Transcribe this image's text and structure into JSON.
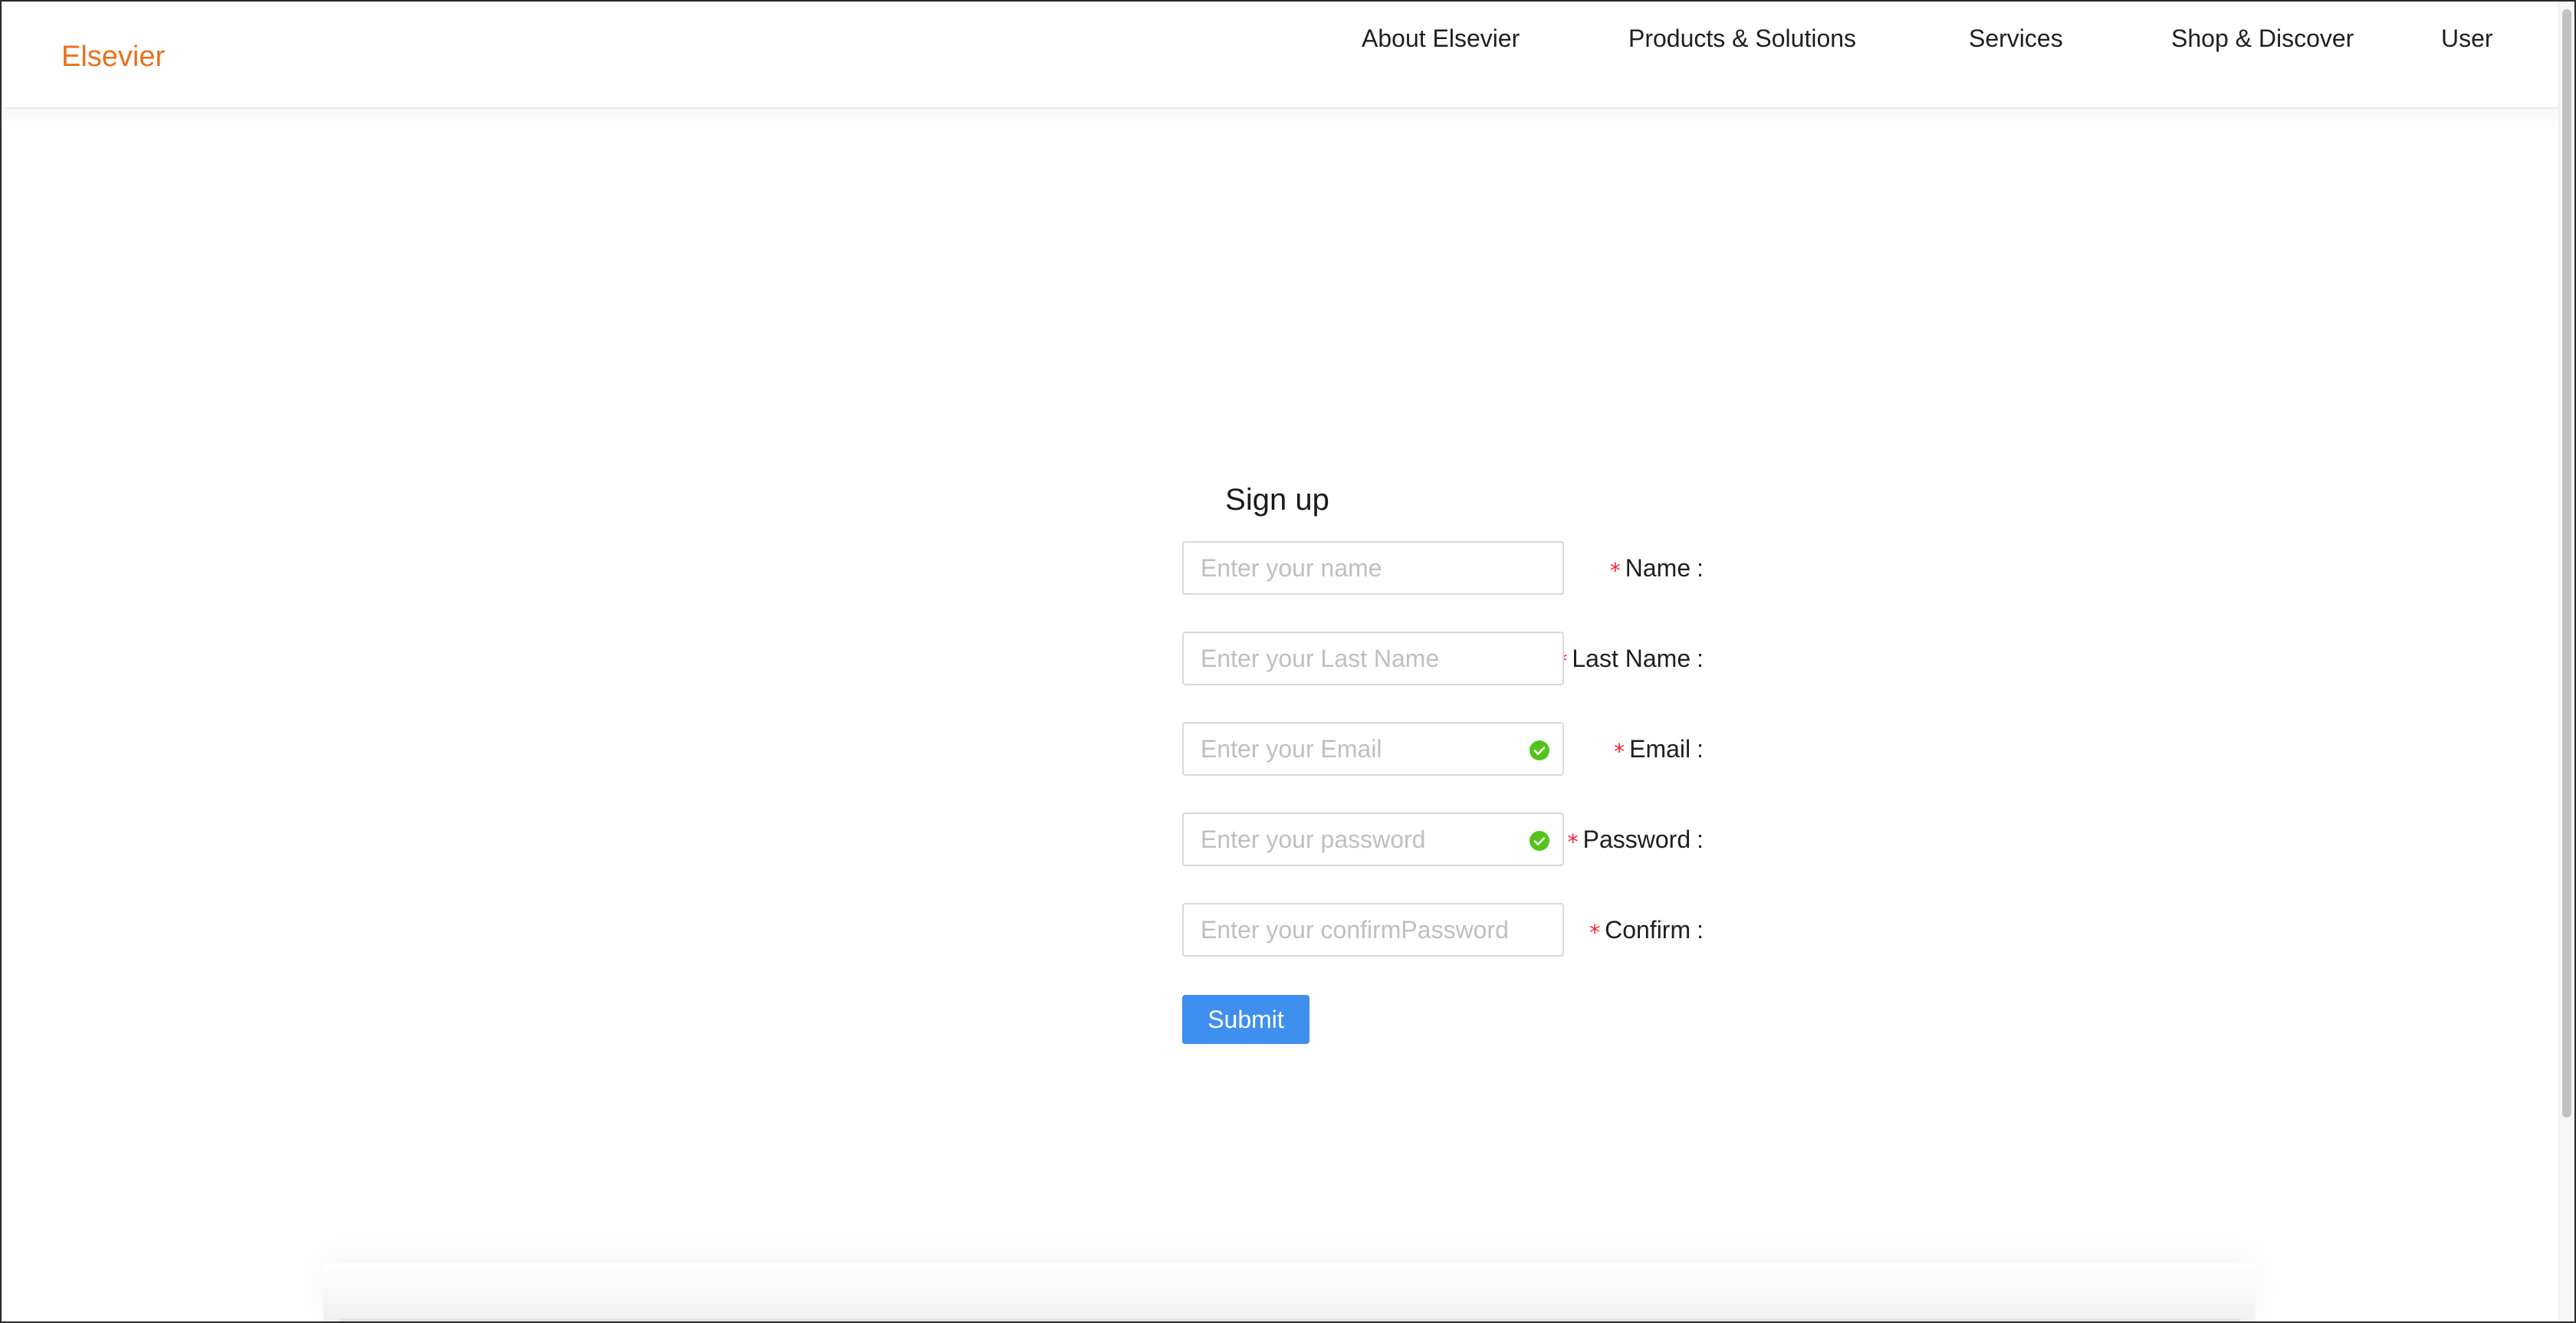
{
  "header": {
    "logo": "Elsevier",
    "nav": [
      {
        "label": "About Elsevier"
      },
      {
        "label": "Products & Solutions"
      },
      {
        "label": "Services"
      },
      {
        "label": "Shop & Discover"
      },
      {
        "label": "User"
      }
    ]
  },
  "form": {
    "title": "Sign up",
    "required_marker": "*",
    "fields": [
      {
        "label": "Name",
        "placeholder": "Enter your name",
        "value": "",
        "validated": false
      },
      {
        "label": "Last Name",
        "placeholder": "Enter your Last Name",
        "value": "",
        "validated": false
      },
      {
        "label": "Email",
        "placeholder": "Enter your Email",
        "value": "",
        "validated": true
      },
      {
        "label": "Password",
        "placeholder": "Enter your password",
        "value": "",
        "validated": true
      },
      {
        "label": "Confirm",
        "placeholder": "Enter your confirmPassword",
        "value": "",
        "validated": false
      }
    ],
    "submit_label": "Submit"
  },
  "icons": {
    "validated": "check-circle-icon"
  },
  "colors": {
    "brand": "#e9711c",
    "primary": "#3f8fef",
    "required": "#f5222d",
    "success": "#52c41a"
  }
}
